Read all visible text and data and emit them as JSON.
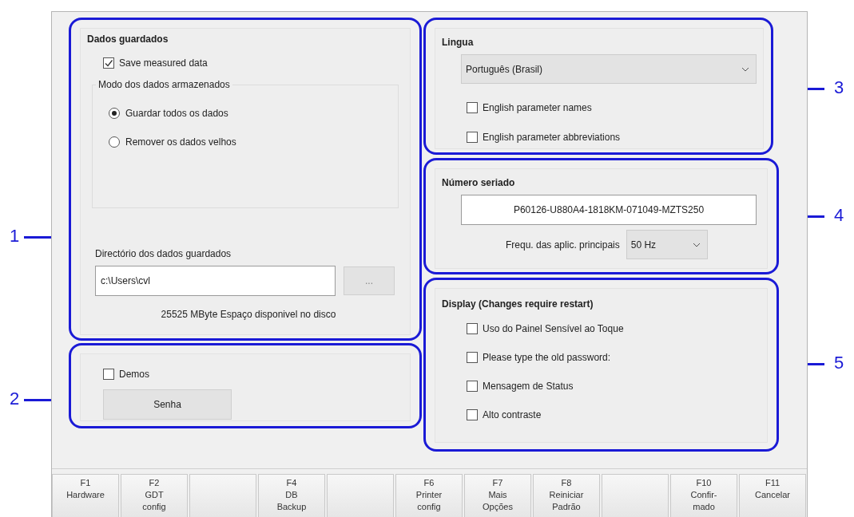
{
  "callouts": [
    {
      "number": "1"
    },
    {
      "number": "2"
    },
    {
      "number": "3"
    },
    {
      "number": "4"
    },
    {
      "number": "5"
    }
  ],
  "stored_data": {
    "title": "Dados guardados",
    "save_checkbox": {
      "label": "Save measured data",
      "checked": true
    },
    "mode_group": {
      "legend": "Modo dos dados armazenados",
      "options": [
        {
          "label": "Guardar todos os dados",
          "selected": true
        },
        {
          "label": "Remover os dados velhos",
          "selected": false
        }
      ]
    },
    "directory_label": "Directório dos dados guardados",
    "directory_value": "c:\\Users\\cvl",
    "browse_button": "...",
    "free_space": "25525 MByte  Espaço disponivel no disco"
  },
  "demos": {
    "checkbox": {
      "label": "Demos",
      "checked": false
    },
    "password_button": "Senha"
  },
  "language": {
    "title": "Lingua",
    "selected_language": "Português (Brasil)",
    "options": [
      {
        "label": "English parameter names",
        "checked": false
      },
      {
        "label": "English parameter abbreviations",
        "checked": false
      }
    ]
  },
  "serial": {
    "title": "Número seriado",
    "serial_value": "P60126-U880A4-1818KM-071049-MZTS250",
    "frequency_label": "Frequ. das aplic. principais",
    "frequency_value": "50 Hz"
  },
  "display": {
    "title": "Display (Changes require restart)",
    "options": [
      {
        "label": "Uso do Painel Sensível ao Toque",
        "checked": false
      },
      {
        "label": "Please type the old password:",
        "checked": false
      },
      {
        "label": "Mensagem de Status",
        "checked": false
      },
      {
        "label": "Alto contraste",
        "checked": false
      }
    ]
  },
  "function_keys": [
    {
      "kind": "key",
      "lines": [
        "F1",
        "Hardware"
      ]
    },
    {
      "kind": "key",
      "lines": [
        "F2",
        "GDT",
        "config"
      ]
    },
    {
      "kind": "blank"
    },
    {
      "kind": "key",
      "lines": [
        "F4",
        "DB",
        "Backup"
      ]
    },
    {
      "kind": "blank"
    },
    {
      "kind": "key",
      "lines": [
        "F6",
        "Printer",
        "config"
      ]
    },
    {
      "kind": "key",
      "lines": [
        "F7",
        "Mais",
        "Opções"
      ]
    },
    {
      "kind": "key",
      "lines": [
        "F8",
        "Reiniciar",
        "Padrão"
      ]
    },
    {
      "kind": "blank"
    },
    {
      "kind": "key",
      "lines": [
        "F10",
        "Confir-",
        "mado"
      ]
    },
    {
      "kind": "key",
      "lines": [
        "F11",
        "Cancelar"
      ]
    }
  ]
}
